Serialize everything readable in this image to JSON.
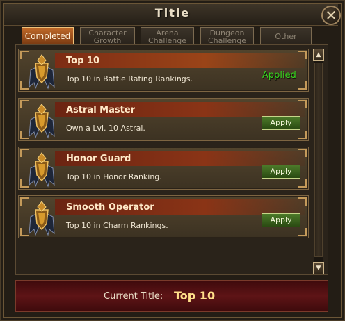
{
  "window": {
    "title": "Title",
    "close_symbol": "✕"
  },
  "tabs": [
    {
      "label": "Completed",
      "active": true
    },
    {
      "label": "Character Growth",
      "active": false
    },
    {
      "label": "Arena Challenge",
      "active": false
    },
    {
      "label": "Dungeon Challenge",
      "active": false
    },
    {
      "label": "Other",
      "active": false
    }
  ],
  "titles": [
    {
      "name": "Top 10",
      "description": "Top 10 in Battle Rating Rankings.",
      "status": "Applied",
      "icon": "winged-crest-icon"
    },
    {
      "name": "Astral Master",
      "description": "Own a Lvl. 10 Astral.",
      "button_label": "Apply",
      "icon": "winged-crest-icon"
    },
    {
      "name": "Honor Guard",
      "description": "Top 10 in Honor Ranking.",
      "button_label": "Apply",
      "icon": "winged-crest-icon"
    },
    {
      "name": "Smooth Operator",
      "description": "Top 10 in Charm Rankings.",
      "button_label": "Apply",
      "icon": "winged-crest-icon"
    }
  ],
  "scrollbar": {
    "up_symbol": "▲",
    "down_symbol": "▼"
  },
  "footer": {
    "label": "Current Title:",
    "value": "Top 10"
  },
  "colors": {
    "applied_text": "#37d41e",
    "apply_button": "#3b6a1e",
    "active_tab": "#b05c22",
    "title_name_bar": "#7d2c14",
    "footer_bg": "#5e1416",
    "footer_value": "#ffe08a"
  }
}
